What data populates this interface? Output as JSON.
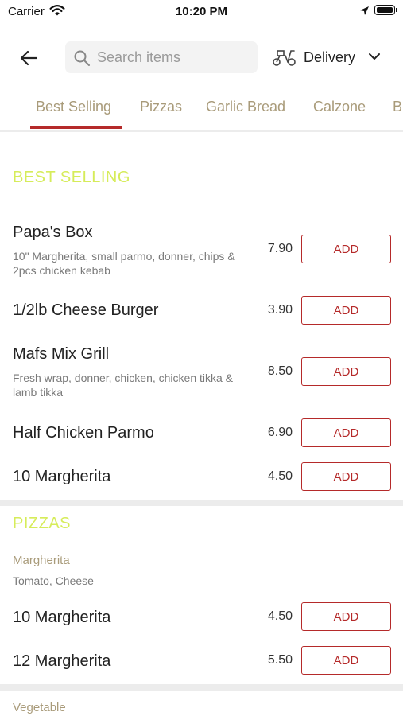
{
  "status_bar": {
    "carrier": "Carrier",
    "time": "10:20 PM"
  },
  "header": {
    "search": {
      "placeholder": "Search items",
      "value": ""
    },
    "delivery_label": "Delivery"
  },
  "tabs": [
    {
      "label": "Best Selling",
      "active": true
    },
    {
      "label": "Pizzas"
    },
    {
      "label": "Garlic Bread"
    },
    {
      "label": "Calzone"
    },
    {
      "label": "B"
    }
  ],
  "best_selling": {
    "title": "BEST SELLING",
    "items": [
      {
        "name": "Papa's Box",
        "desc": "10\" Margherita, small parmo, donner, chips & 2pcs chicken kebab",
        "price": "7.90",
        "add": "ADD"
      },
      {
        "name": "1/2lb Cheese Burger",
        "price": "3.90",
        "add": "ADD"
      },
      {
        "name": "Mafs Mix Grill",
        "desc": "Fresh wrap, donner, chicken, chicken tikka & lamb tikka",
        "price": "8.50",
        "add": "ADD"
      },
      {
        "name": "Half Chicken Parmo",
        "price": "6.90",
        "add": "ADD"
      },
      {
        "name": "10 Margherita",
        "price": "4.50",
        "add": "ADD"
      }
    ]
  },
  "pizzas": {
    "title": "PIZZAS",
    "groups": [
      {
        "name": "Margherita",
        "desc": "Tomato, Cheese",
        "items": [
          {
            "name": "10 Margherita",
            "price": "4.50",
            "add": "ADD"
          },
          {
            "name": "12 Margherita",
            "price": "5.50",
            "add": "ADD"
          }
        ]
      },
      {
        "name": "Vegetable"
      }
    ]
  },
  "colors": {
    "accent": "#b52a2a",
    "section_title": "#d6ec5a",
    "tab_text": "#a99b7a"
  }
}
